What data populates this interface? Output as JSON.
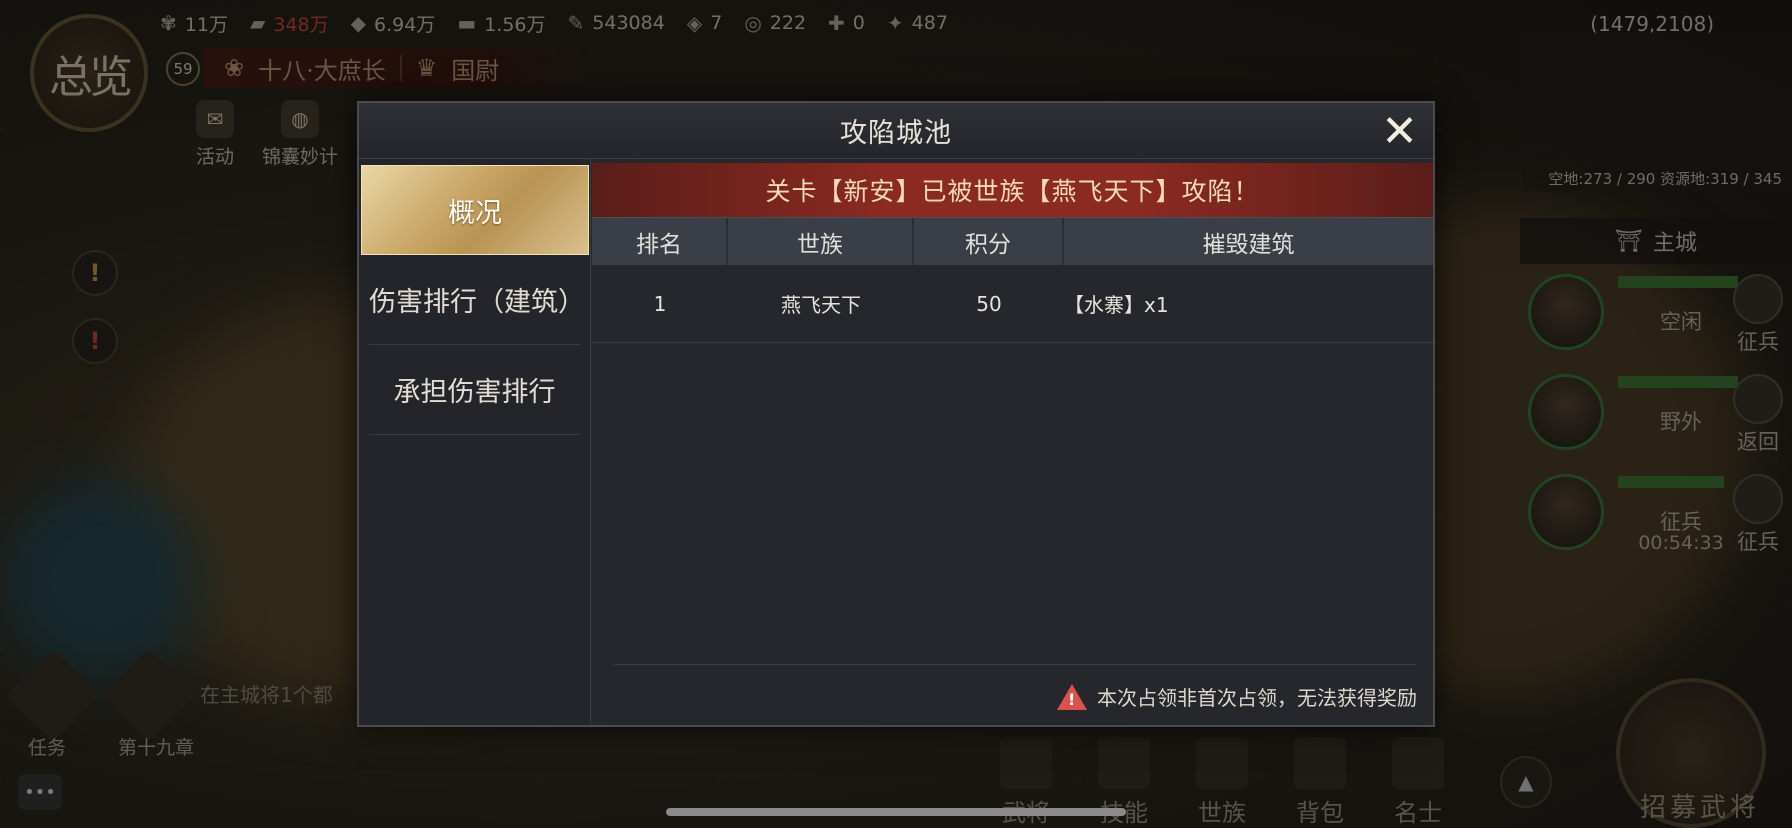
{
  "hud": {
    "resources": [
      {
        "icon": "wheat-icon",
        "value": "11万"
      },
      {
        "icon": "wood-icon",
        "value": "348万",
        "warn": true
      },
      {
        "icon": "stone-icon",
        "value": "6.94万"
      },
      {
        "icon": "iron-icon",
        "value": "1.56万"
      },
      {
        "icon": "feather-icon",
        "value": "543084"
      },
      {
        "icon": "jade-icon",
        "value": "7"
      },
      {
        "icon": "coin-icon",
        "value": "222"
      },
      {
        "icon": "cart-icon",
        "value": "0"
      },
      {
        "icon": "token-icon",
        "value": "487"
      }
    ],
    "coords": "(1479,2108)",
    "avatar_text": "总览",
    "level": "59",
    "rank_title": "十八·大庶长",
    "state_name": "国尉",
    "activities": [
      "活动",
      "锦囊妙计"
    ],
    "land_info": "空地:273 / 290  资源地:319 / 345",
    "main_city": "主城",
    "troops": [
      {
        "state": "空闲",
        "timer": "",
        "action": "征兵"
      },
      {
        "state": "野外",
        "timer": "",
        "action": "返回"
      },
      {
        "state": "征兵",
        "timer": "00:54:33",
        "action": "征兵"
      }
    ],
    "task_hint": "在主城将1个都",
    "task_labels": [
      "任务",
      "第十九章"
    ],
    "bottom_nav": [
      "武将",
      "技能",
      "世族",
      "背包",
      "名士"
    ],
    "recruit": "招募武将"
  },
  "modal": {
    "title": "攻陷城池",
    "tabs": [
      "概况",
      "伤害排行（建筑）",
      "承担伤害排行"
    ],
    "banner": "关卡【新安】已被世族【燕飞天下】攻陷！",
    "columns": [
      "排名",
      "世族",
      "积分",
      "摧毁建筑"
    ],
    "rows": [
      {
        "rank": "1",
        "clan": "燕飞天下",
        "score": "50",
        "buildings": "【水寨】x1"
      }
    ],
    "notice": "本次占领非首次占领，无法获得奖励"
  },
  "colors": {
    "accent_gold": "#c9a767",
    "banner_red": "#8a2a22",
    "warn_red": "#d9534a"
  }
}
